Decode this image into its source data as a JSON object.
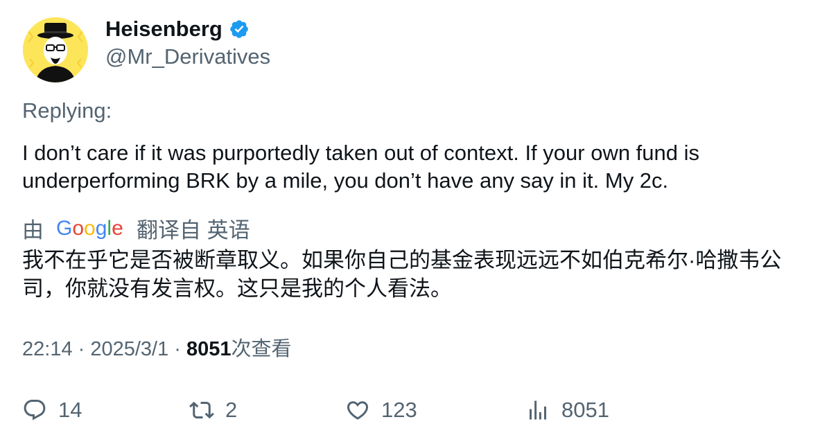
{
  "author": {
    "display_name": "Heisenberg",
    "handle": "@Mr_Derivatives",
    "verified": true,
    "avatar_icon": "heisenberg-avatar"
  },
  "replying_label": "Replying:",
  "tweet": {
    "text": "I don’t care if it was purportedly taken out of context. If your own fund is underperforming BRK by a mile, you don’t have any say in it. My 2c."
  },
  "translation": {
    "prefix": "由",
    "provider_logo": "Google",
    "suffix": "翻译自 英语",
    "text": "我不在乎它是否被断章取义。如果你自己的基金表现远远不如伯克希尔·哈撒韦公司，你就没有发言权。这只是我的个人看法。"
  },
  "meta": {
    "time": "22:14",
    "separator1": " · ",
    "date": "2025/3/1",
    "separator2": " · ",
    "views_count": "8051",
    "views_label": "次查看"
  },
  "actions": {
    "replies": "14",
    "retweets": "2",
    "likes": "123",
    "views": "8051"
  },
  "colors": {
    "verified": "#1d9bf0",
    "secondary_text": "#536471",
    "primary_text": "#0f1419",
    "avatar_bg": "#fde55a"
  }
}
